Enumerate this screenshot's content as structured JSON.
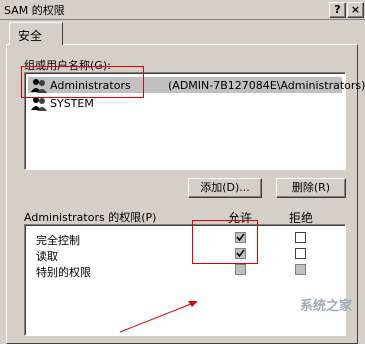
{
  "window": {
    "title": "SAM 的权限",
    "help_btn": "?",
    "close_btn": "×"
  },
  "tabs": [
    {
      "label": "安全"
    }
  ],
  "groups": {
    "label": "组或用户名称(G):",
    "users": [
      {
        "name": "Administrators",
        "detail": "(ADMIN-7B127084E\\Administrators)"
      },
      {
        "name": "SYSTEM",
        "detail": ""
      }
    ]
  },
  "buttons": {
    "add": "添加(D)...",
    "remove": "删除(R)"
  },
  "permissions": {
    "label": "Administrators 的权限(P)",
    "allow_header": "允许",
    "deny_header": "拒绝",
    "rows": [
      {
        "name": "完全控制",
        "allow": true,
        "deny": false
      },
      {
        "name": "读取",
        "allow": true,
        "deny": false
      },
      {
        "name": "特别的权限",
        "allow": false,
        "deny": false
      }
    ]
  },
  "watermark": "系统之家",
  "colors": {
    "annotation": "#e00000",
    "selection": "#c0c0c0",
    "window_bg": "#d4d0c8"
  }
}
